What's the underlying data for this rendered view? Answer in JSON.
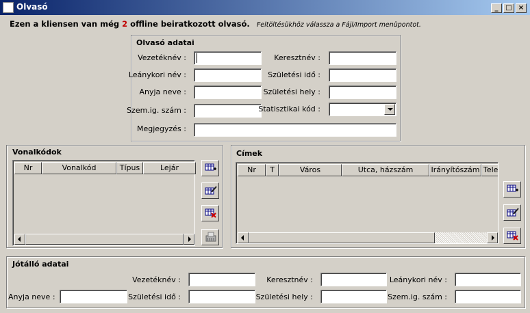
{
  "window": {
    "title": "Olvasó",
    "minimize": "_",
    "maximize": "□",
    "close": "×"
  },
  "info": {
    "prefix": "Ezen a kliensen van még",
    "count": "2",
    "suffix": "offline beiratkozott olvasó.",
    "hint": "Feltöltésükhöz válassza a Fájl/Import menüpontot."
  },
  "olvaso": {
    "title": "Olvasó adatai",
    "vezeteknev_label": "Vezetéknév :",
    "vezeteknev_value": "",
    "keresztnev_label": "Keresztnév :",
    "keresztnev_value": "",
    "leanykori_label": "Leánykori név :",
    "leanykori_value": "",
    "szuletesi_ido_label": "Születési idő :",
    "szuletesi_ido_value": "",
    "anyja_label": "Anyja neve :",
    "anyja_value": "",
    "szuletesi_hely_label": "Születési hely :",
    "szuletesi_hely_value": "",
    "szemig_label": "Szem.ig. szám :",
    "szemig_value": "",
    "stat_label": "Statisztikai kód :",
    "stat_value": "",
    "megjegyzes_label": "Megjegyzés :",
    "megjegyzes_value": ""
  },
  "vonalkodok": {
    "title": "Vonalkódok",
    "columns": [
      "Nr",
      "Vonalkód",
      "Típus",
      "Lejár"
    ]
  },
  "cimek": {
    "title": "Címek",
    "columns": [
      "Nr",
      "T",
      "Város",
      "Utca, házszám",
      "Irányítószám",
      "Tele"
    ]
  },
  "jotallo": {
    "title": "Jótálló adatai",
    "vezeteknev_label": "Vezetéknév :",
    "vezeteknev_value": "",
    "keresztnev_label": "Keresztnév :",
    "keresztnev_value": "",
    "leanykori_label": "Leánykori név :",
    "leanykori_value": "",
    "anyja_label": "Anyja neve :",
    "anyja_value": "",
    "szuletesi_ido_label": "Születési idő :",
    "szuletesi_ido_value": "",
    "szuletesi_hely_label": "Születési hely :",
    "szuletesi_hely_value": "",
    "szemig_label": "Szem.ig. szám :",
    "szemig_value": ""
  }
}
